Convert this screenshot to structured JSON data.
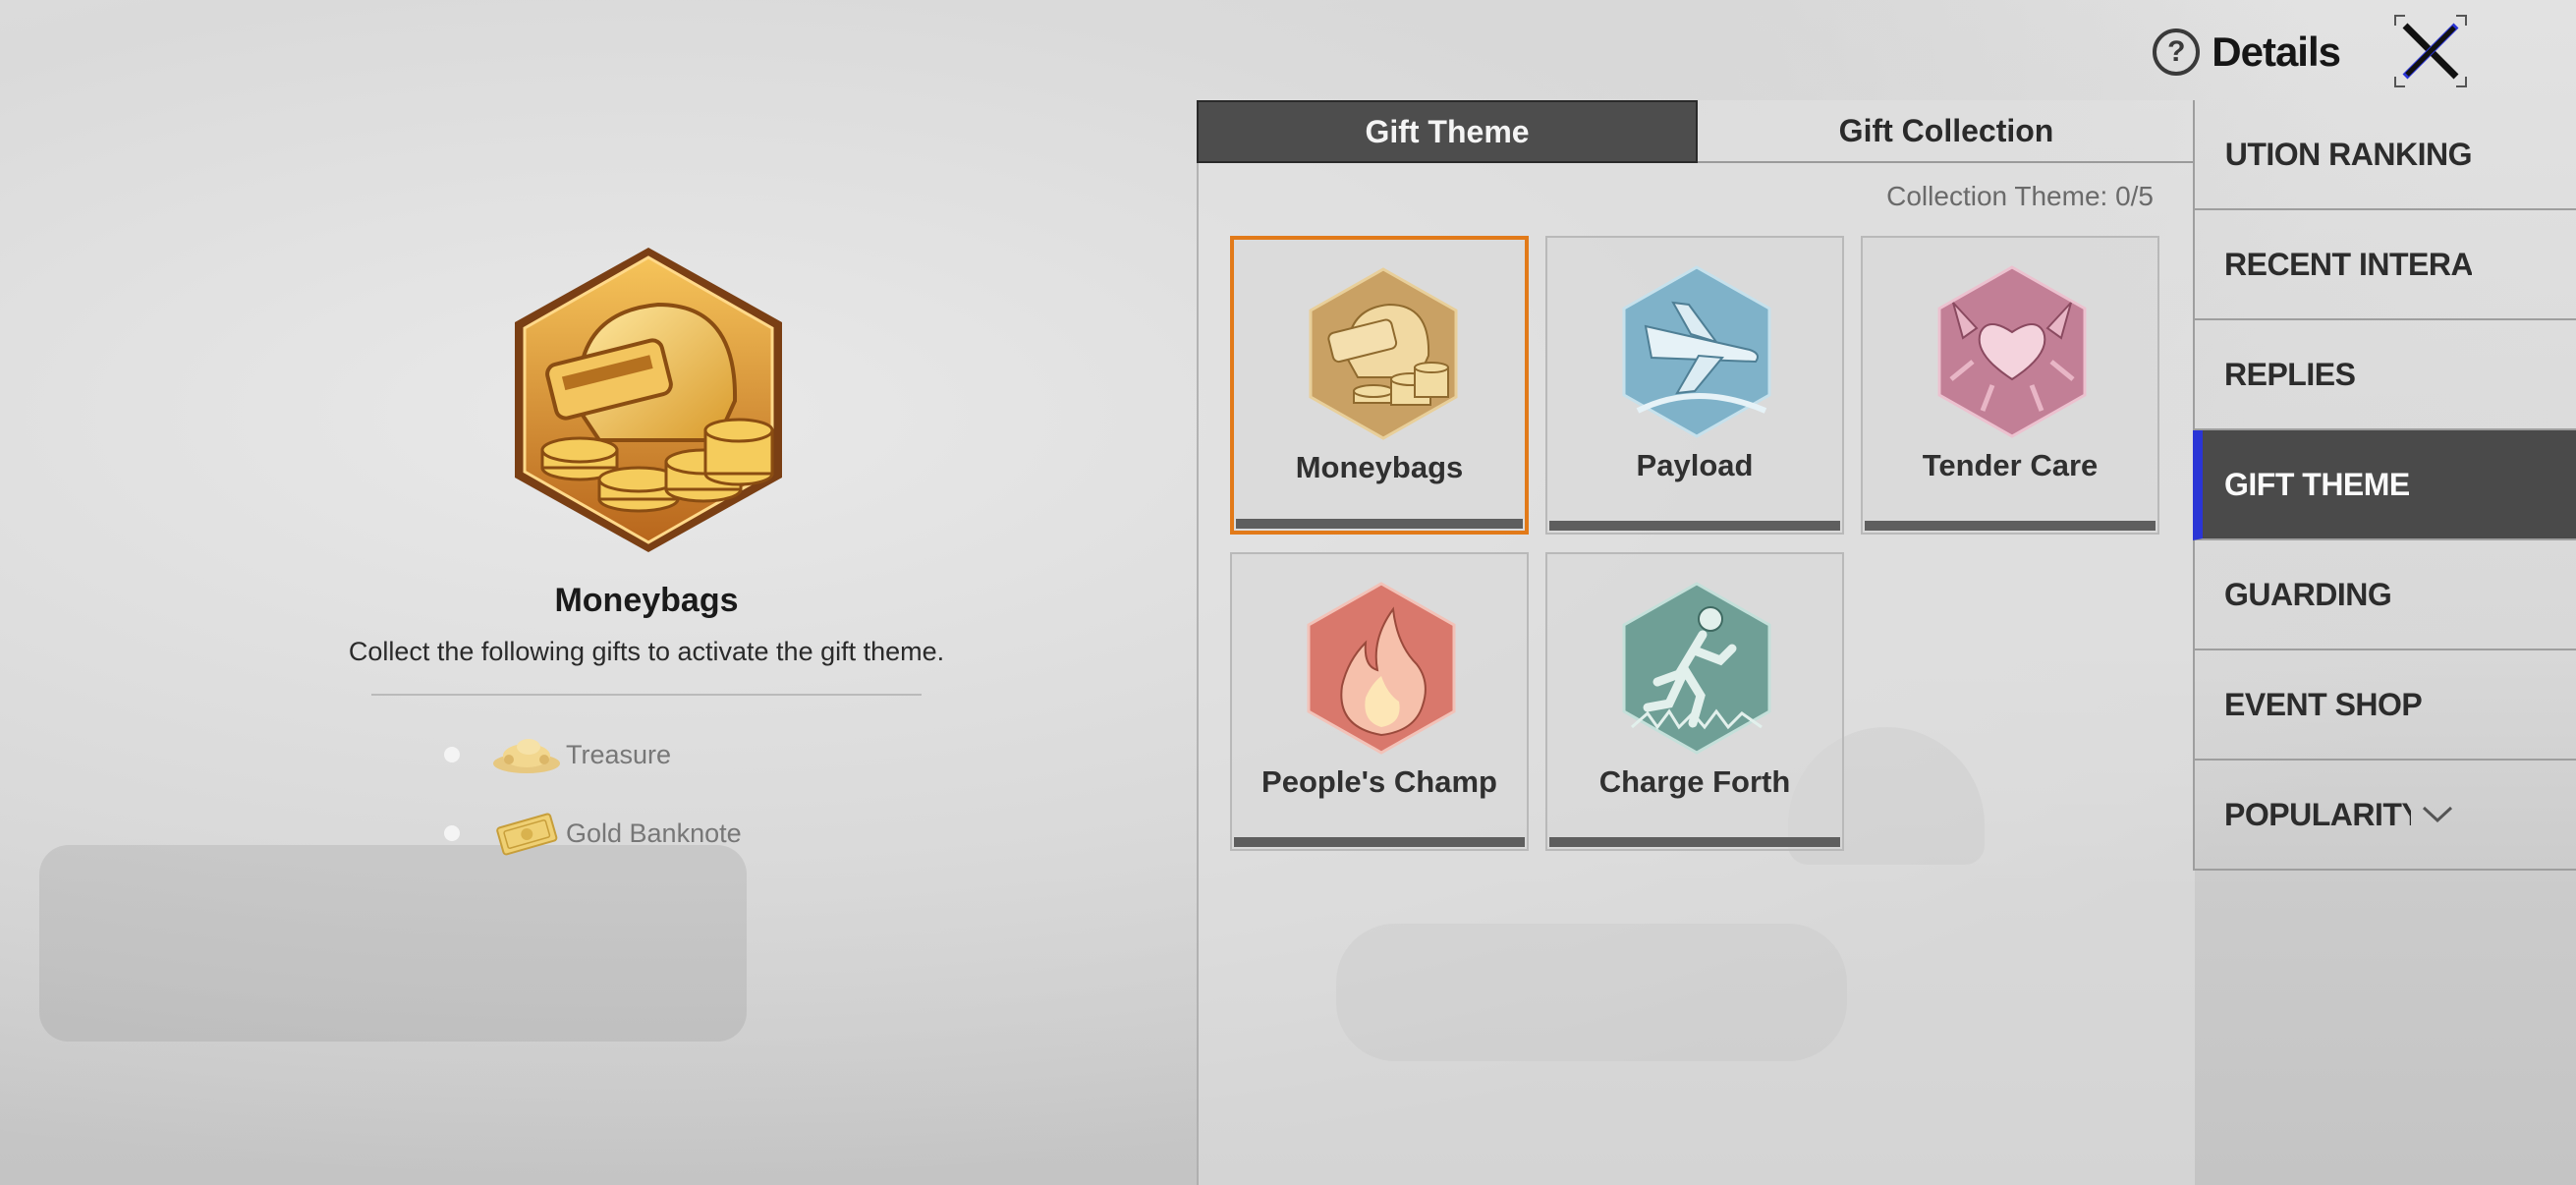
{
  "header": {
    "title": "Details",
    "help_icon": "question-circle-icon",
    "close_icon": "close-x-icon"
  },
  "detail": {
    "name": "Moneybags",
    "description": "Collect the following gifts to activate the gift theme.",
    "badge_icon": "moneybags-helmet-coins-icon",
    "required_gifts": [
      {
        "label": "Treasure",
        "icon": "treasure-pile-icon"
      },
      {
        "label": "Gold Banknote",
        "icon": "gold-banknote-icon"
      }
    ]
  },
  "tabs": [
    {
      "label": "Gift Theme",
      "active": true
    },
    {
      "label": "Gift Collection",
      "active": false
    }
  ],
  "collection_theme": "Collection Theme: 0/5",
  "themes": [
    {
      "name": "Moneybags",
      "icon": "moneybags-icon",
      "selected": true,
      "color": "#d9a74a"
    },
    {
      "name": "Payload",
      "icon": "airplane-icon",
      "selected": false,
      "color": "#7fb6cf"
    },
    {
      "name": "Tender Care",
      "icon": "heart-wings-icon",
      "selected": false,
      "color": "#c98aa0"
    },
    {
      "name": "People's Champ",
      "icon": "flame-icon",
      "selected": false,
      "color": "#e08a7e"
    },
    {
      "name": "Charge Forth",
      "icon": "runner-icon",
      "selected": false,
      "color": "#79a9a0"
    }
  ],
  "sidebar": {
    "items": [
      {
        "label": "CONTRIBUTION RANKING",
        "active": false
      },
      {
        "label": "RECENT INTERACTIONS",
        "active": false
      },
      {
        "label": "REPLIES",
        "active": false
      },
      {
        "label": "GIFT THEME",
        "active": true
      },
      {
        "label": "GUARDING",
        "active": false
      },
      {
        "label": "EVENT SHOP",
        "active": false
      },
      {
        "label": "POPULARITY BATTLE",
        "active": false,
        "expand_icon": "chevron-down-icon"
      }
    ]
  },
  "colors": {
    "selected_border": "#e27a19",
    "active_indicator": "#2a35d6",
    "active_tab_bg": "#4d4d4d"
  }
}
